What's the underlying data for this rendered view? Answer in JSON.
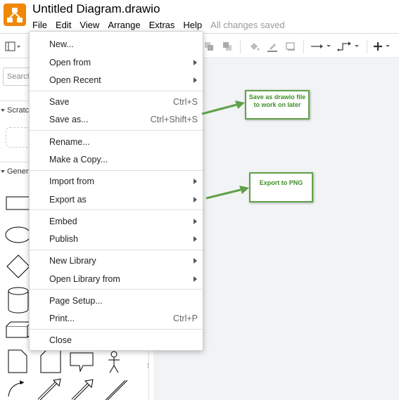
{
  "app": {
    "title": "Untitled Diagram.drawio",
    "status": "All changes saved"
  },
  "menubar": {
    "items": [
      "File",
      "Edit",
      "View",
      "Arrange",
      "Extras",
      "Help"
    ]
  },
  "sidebar": {
    "search_placeholder": "Search",
    "sections": [
      "Scratch",
      "General"
    ]
  },
  "file_menu": {
    "items": [
      {
        "label": "New...",
        "shortcut": "",
        "submenu": false
      },
      {
        "label": "Open from",
        "shortcut": "",
        "submenu": true
      },
      {
        "label": "Open Recent",
        "shortcut": "",
        "submenu": true
      },
      {
        "label": "Save",
        "shortcut": "Ctrl+S",
        "submenu": false
      },
      {
        "label": "Save as...",
        "shortcut": "Ctrl+Shift+S",
        "submenu": false
      },
      {
        "label": "Rename...",
        "shortcut": "",
        "submenu": false
      },
      {
        "label": "Make a Copy...",
        "shortcut": "",
        "submenu": false
      },
      {
        "label": "Import from",
        "shortcut": "",
        "submenu": true
      },
      {
        "label": "Export as",
        "shortcut": "",
        "submenu": true
      },
      {
        "label": "Embed",
        "shortcut": "",
        "submenu": true
      },
      {
        "label": "Publish",
        "shortcut": "",
        "submenu": true
      },
      {
        "label": "New Library",
        "shortcut": "",
        "submenu": true
      },
      {
        "label": "Open Library from",
        "shortcut": "",
        "submenu": true
      },
      {
        "label": "Page Setup...",
        "shortcut": "",
        "submenu": false
      },
      {
        "label": "Print...",
        "shortcut": "Ctrl+P",
        "submenu": false
      },
      {
        "label": "Close",
        "shortcut": "",
        "submenu": false
      }
    ]
  },
  "annotations": {
    "save_note": "Save as drawio file to work on later",
    "export_note": "Export to PNG"
  },
  "colors": {
    "logo": "#f08705",
    "annotation_green": "#61a04a",
    "canvas_bg": "#f1f3f4"
  }
}
